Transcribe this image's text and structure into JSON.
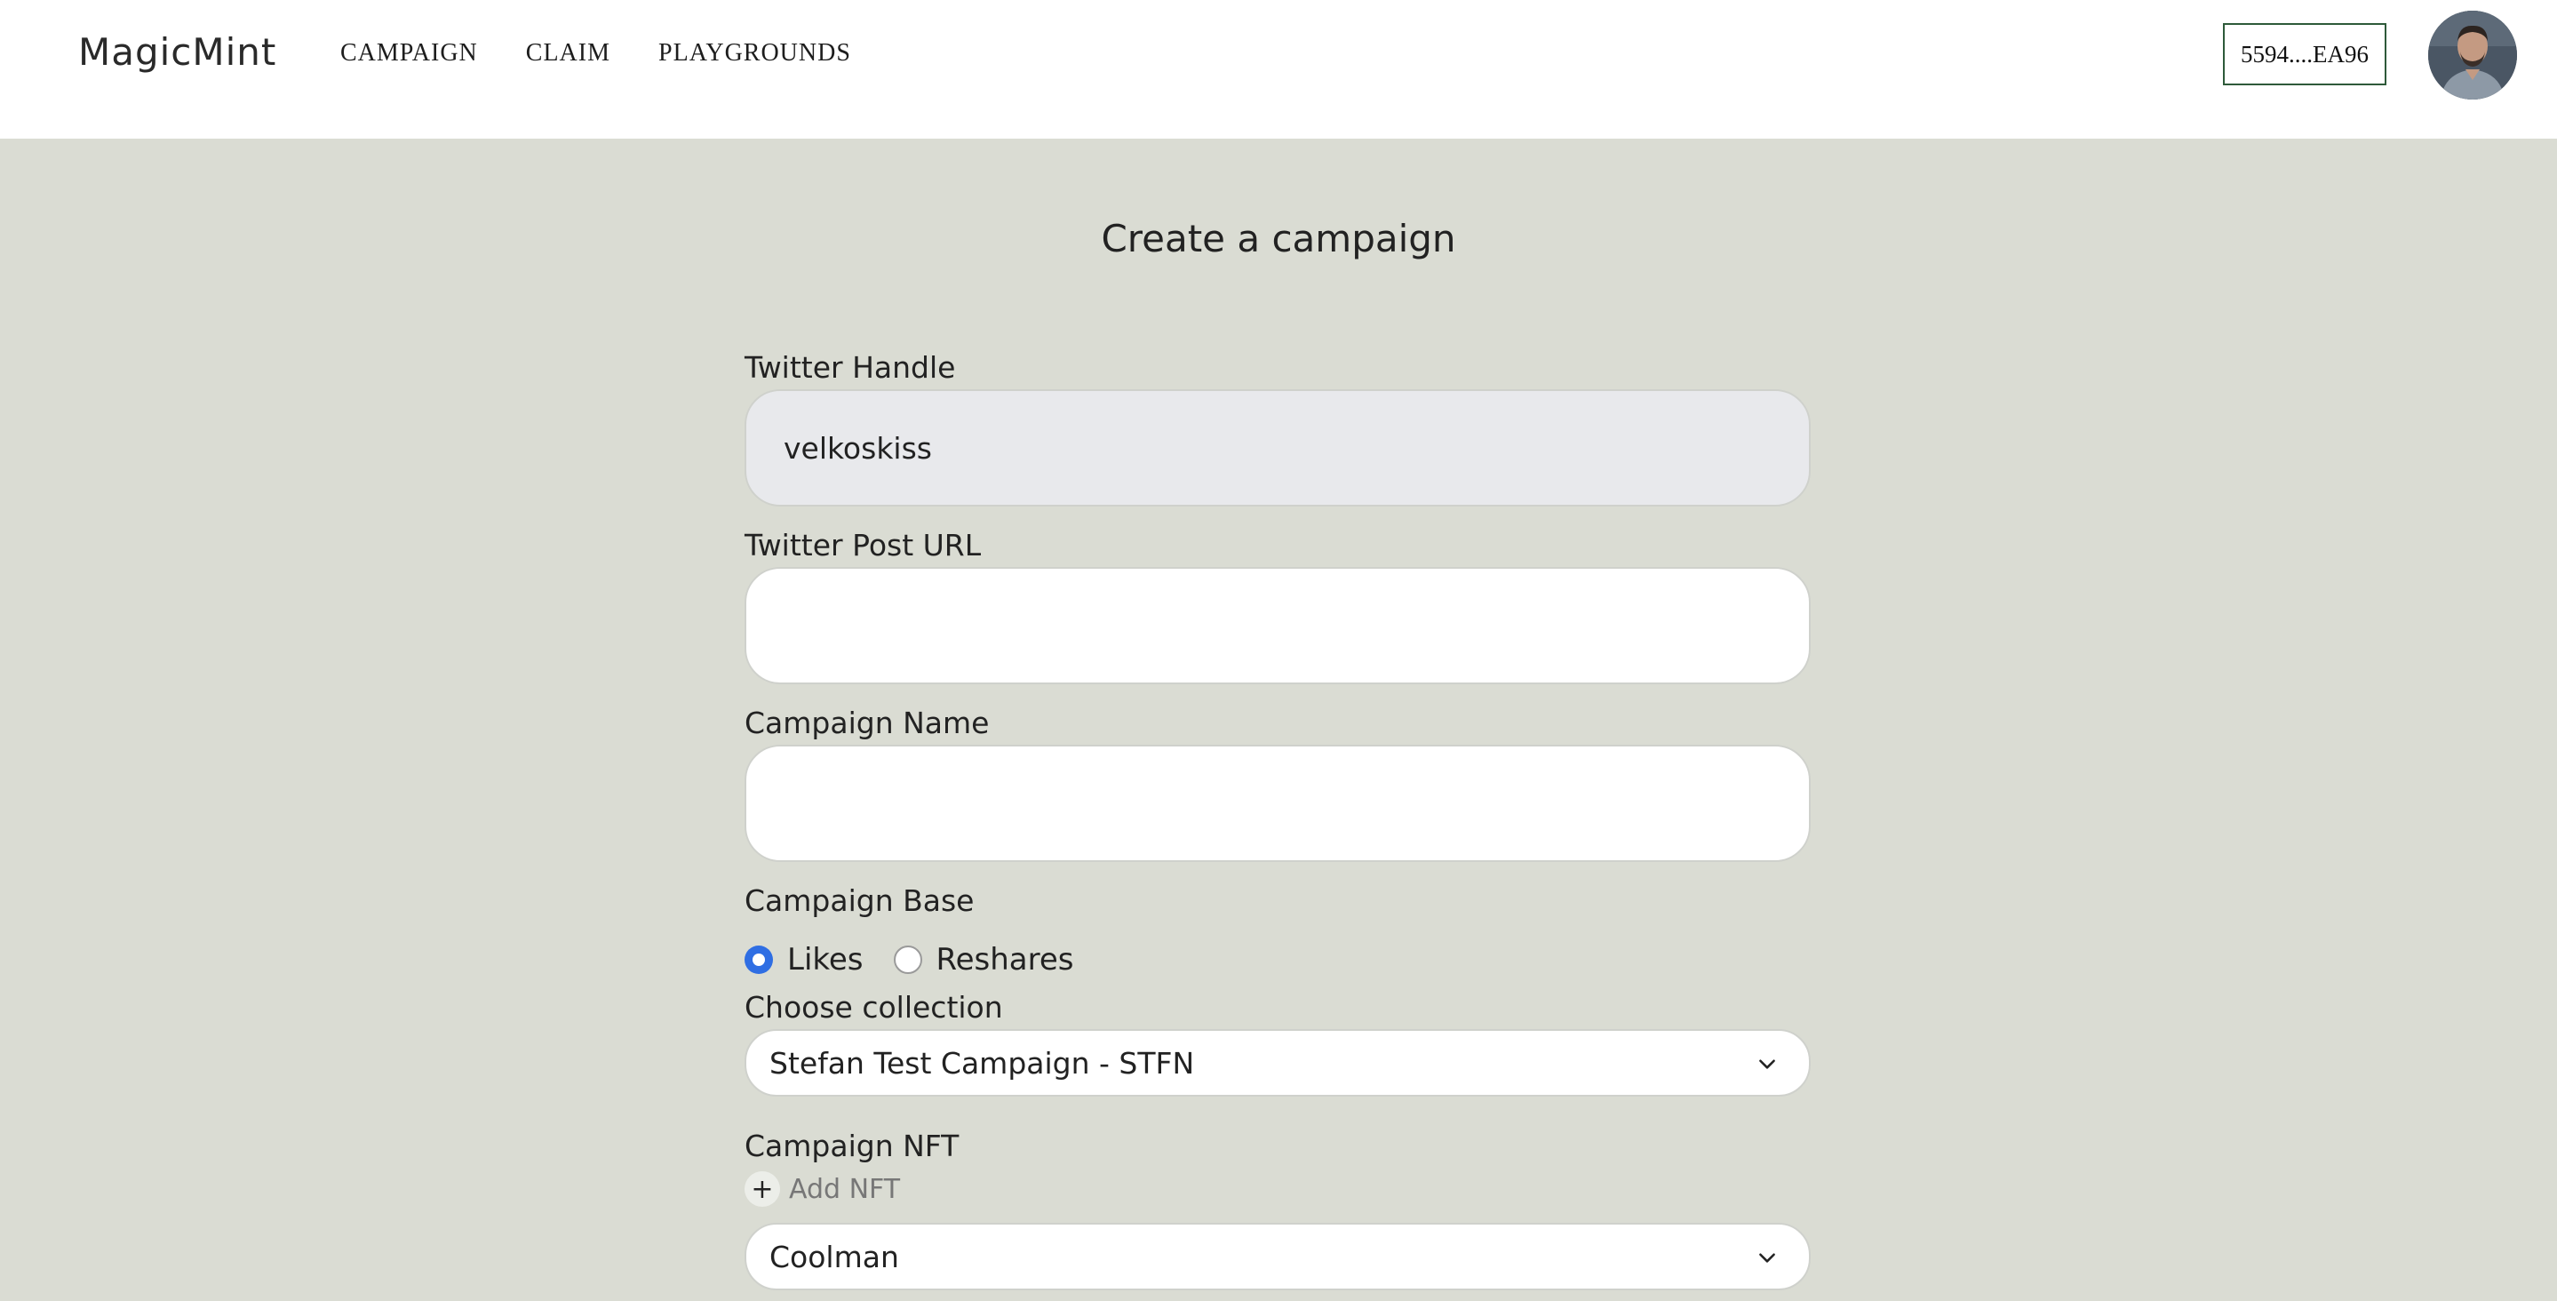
{
  "header": {
    "brand": "MagicMint",
    "nav": [
      "CAMPAIGN",
      "CLAIM",
      "PLAYGROUNDS"
    ],
    "wallet": "5594....EA96"
  },
  "page": {
    "title": "Create a campaign"
  },
  "form": {
    "twitter_handle": {
      "label": "Twitter Handle",
      "value": "velkoskiss"
    },
    "twitter_post_url": {
      "label": "Twitter Post URL",
      "value": ""
    },
    "campaign_name": {
      "label": "Campaign Name",
      "value": ""
    },
    "campaign_base": {
      "label": "Campaign Base",
      "options": [
        "Likes",
        "Reshares"
      ],
      "selected": "Likes"
    },
    "collection": {
      "label": "Choose collection",
      "selected": "Stefan Test Campaign - STFN"
    },
    "campaign_nft": {
      "label": "Campaign NFT",
      "add_label": "Add NFT",
      "selected": "Coolman"
    }
  },
  "colors": {
    "background": "#dadcd3",
    "header": "#ffffff",
    "radio_accent": "#2f6ee3",
    "wallet_border": "#2e5a3a"
  },
  "icons": {
    "dropdown": "chevron-down-icon",
    "add": "plus-icon"
  }
}
